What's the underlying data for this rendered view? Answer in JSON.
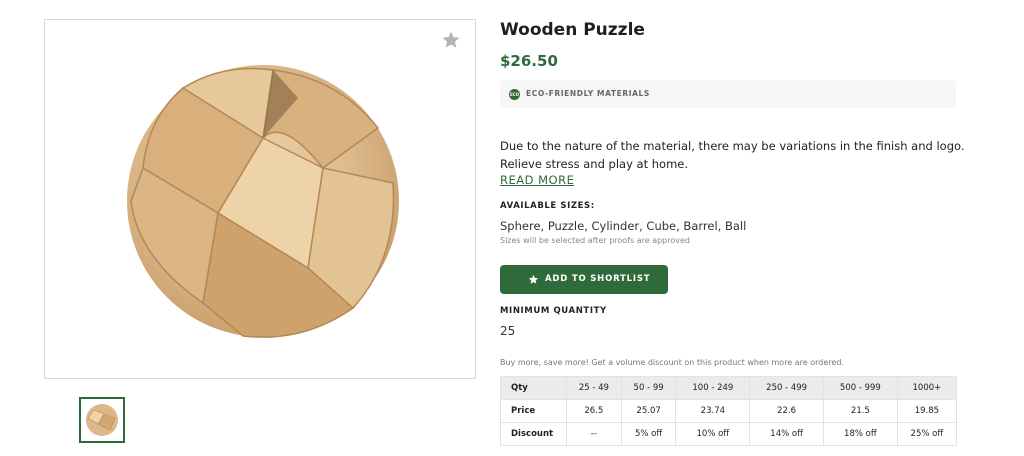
{
  "product": {
    "title": "Wooden Puzzle",
    "price": "$26.50",
    "badge_label": "ECO-FRIENDLY MATERIALS",
    "badge_icon_text": "ECO",
    "description_line1": "Due to the nature of the material, there may be variations in the finish and logo.",
    "description_line2": "Relieve stress and play at home.",
    "read_more": "READ MORE",
    "sizes_heading": "AVAILABLE SIZES:",
    "sizes_value": "Sphere, Puzzle, Cylinder, Cube, Barrel, Ball",
    "sizes_note": "Sizes will be selected after proofs are approved",
    "shortlist_button": "ADD TO SHORTLIST",
    "min_qty_heading": "MINIMUM QUANTITY",
    "min_qty_value": "25",
    "volume_note": "Buy more, save more! Get a volume discount on this product when more are ordered."
  },
  "pricing_table": {
    "qty_label": "Qty",
    "tiers": [
      "25 - 49",
      "50 - 99",
      "100 - 249",
      "250 - 499",
      "500 - 999",
      "1000+"
    ],
    "price_label": "Price",
    "prices": [
      "26.5",
      "25.07",
      "23.74",
      "22.6",
      "21.5",
      "19.85"
    ],
    "discount_label": "Discount",
    "discounts": [
      "--",
      "5% off",
      "10% off",
      "14% off",
      "18% off",
      "25% off"
    ]
  },
  "icons": {
    "favorite": "star-icon",
    "button": "star-icon",
    "badge": "eco-leaf-icon"
  },
  "colors": {
    "accent": "#2f6b3a",
    "badge_bg": "#f6f6f6",
    "table_header_bg": "#e9ece9",
    "wood": "#dcb889"
  }
}
